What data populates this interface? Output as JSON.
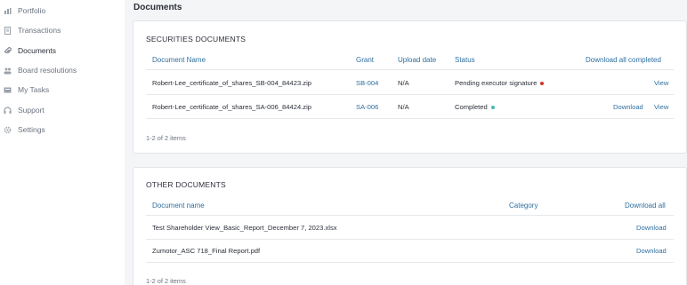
{
  "sidebar": {
    "items": [
      {
        "label": "Portfolio",
        "icon": "bar-chart-icon",
        "active": false
      },
      {
        "label": "Transactions",
        "icon": "document-icon",
        "active": false
      },
      {
        "label": "Documents",
        "icon": "paperclip-icon",
        "active": true
      },
      {
        "label": "Board resolutions",
        "icon": "people-icon",
        "active": false
      },
      {
        "label": "My Tasks",
        "icon": "inbox-icon",
        "active": false
      },
      {
        "label": "Support",
        "icon": "headset-icon",
        "active": false
      },
      {
        "label": "Settings",
        "icon": "gear-icon",
        "active": false
      }
    ]
  },
  "page": {
    "title": "Documents"
  },
  "securities": {
    "title": "SECURITIES DOCUMENTS",
    "headers": {
      "name": "Document Name",
      "grant": "Grant",
      "upload_date": "Upload date",
      "status": "Status",
      "download_all": "Download all completed"
    },
    "rows": [
      {
        "name": "Robert-Lee_certificate_of_shares_SB-004_84423.zip",
        "grant": "SB-004",
        "upload_date": "N/A",
        "status": "Pending executor signature",
        "status_color": "#d0342c",
        "download": "",
        "view": "View"
      },
      {
        "name": "Robert-Lee_certificate_of_shares_SA-006_84424.zip",
        "grant": "SA-006",
        "upload_date": "N/A",
        "status": "Completed",
        "status_color": "#49b8b0",
        "download": "Download",
        "view": "View"
      }
    ],
    "footer": "1-2 of 2 items"
  },
  "other": {
    "title": "OTHER DOCUMENTS",
    "headers": {
      "name": "Document name",
      "category": "Category",
      "download_all": "Download all"
    },
    "rows": [
      {
        "name": "Test Shareholder View_Basic_Report_December 7, 2023.xlsx",
        "category": "",
        "download": "Download"
      },
      {
        "name": "Zumotor_ASC 718_Final Report.pdf",
        "category": "",
        "download": "Download"
      }
    ],
    "footer": "1-2 of 2 items"
  },
  "colors": {
    "accent": "#2f6f9f",
    "status_pending": "#d0342c",
    "status_completed": "#49b8b0"
  }
}
